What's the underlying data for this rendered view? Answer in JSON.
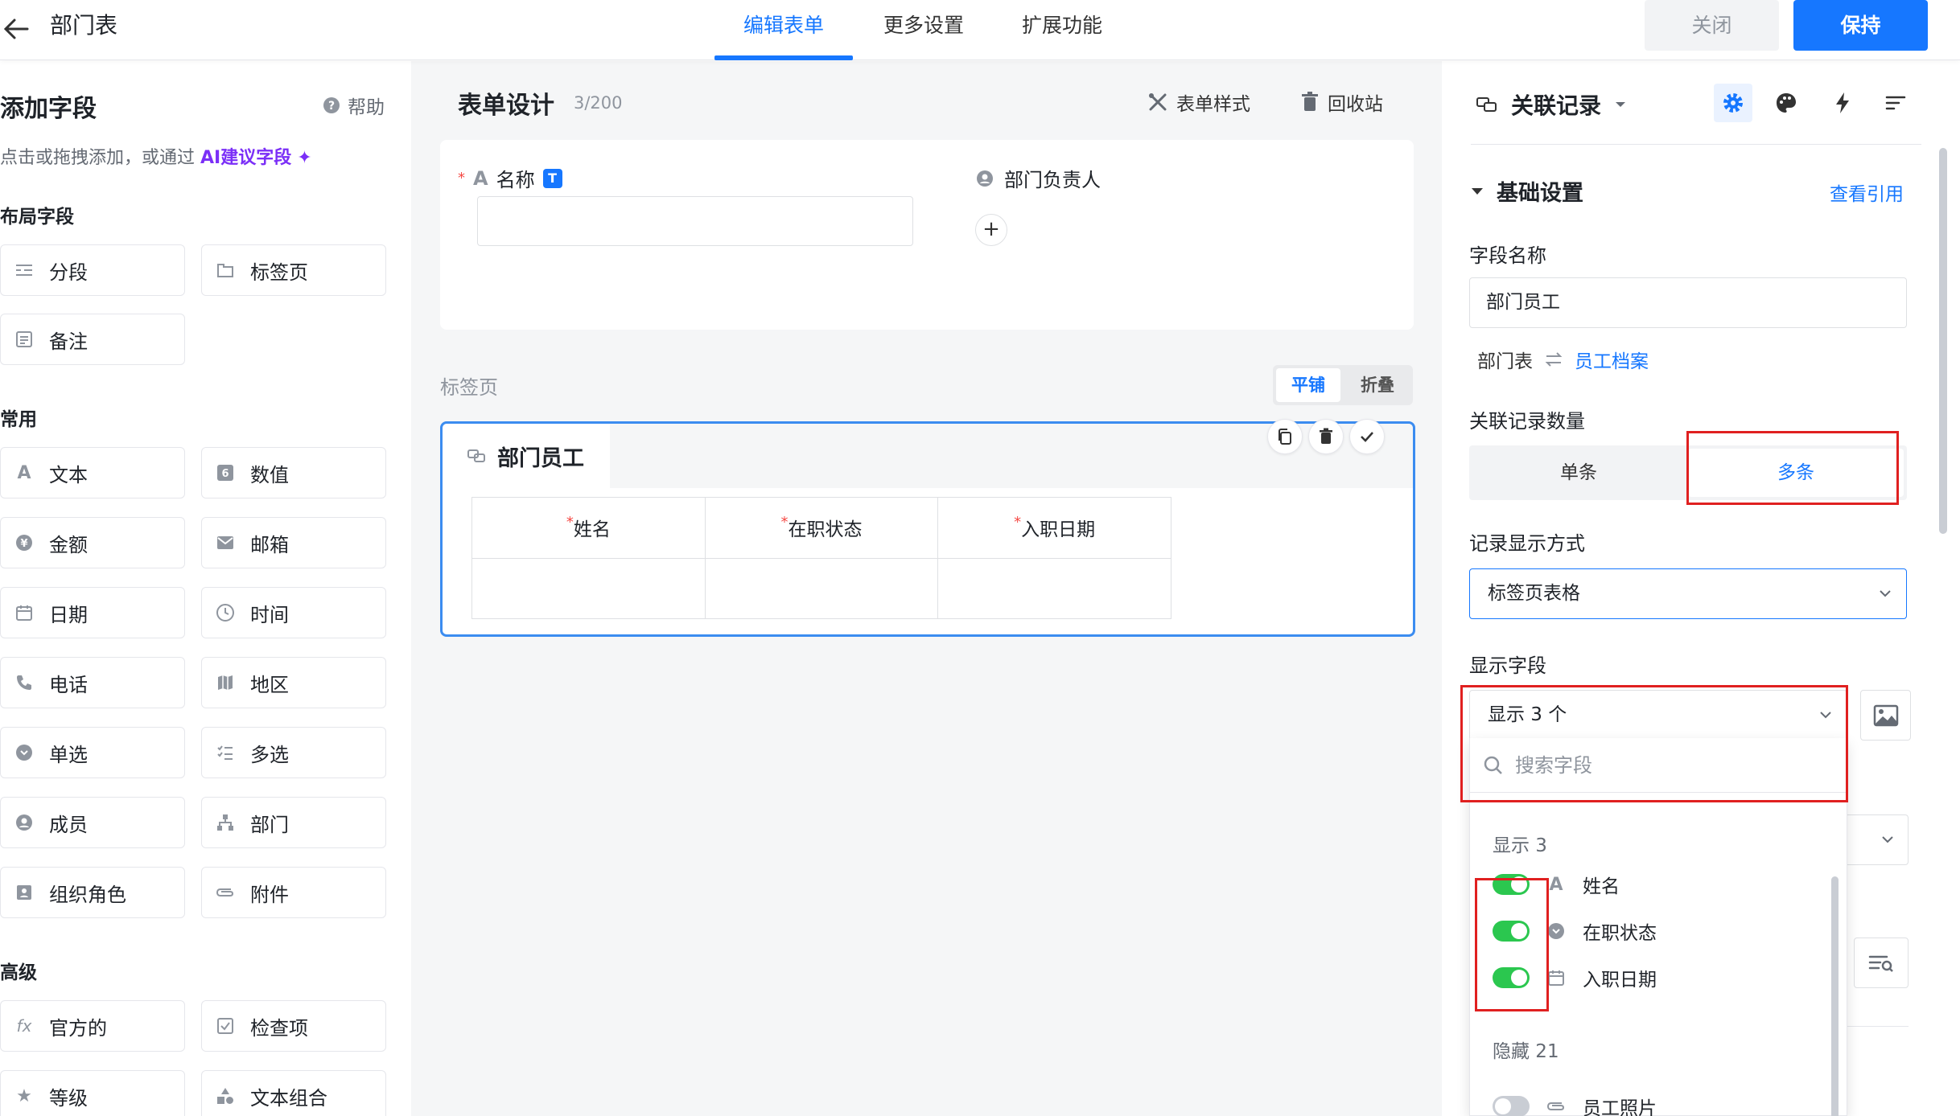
{
  "header": {
    "title": "部门表",
    "tabs": [
      "编辑表单",
      "更多设置",
      "扩展功能"
    ],
    "close_label": "关闭",
    "save_label": "保持"
  },
  "left_panel": {
    "title": "添加字段",
    "help": "帮助",
    "hint_prefix": "点击或拖拽添加，或通过",
    "hint_ai": "AI建议字段",
    "groups": {
      "layout": "布局字段",
      "common": "常用",
      "advanced": "高级"
    },
    "layout_fields": [
      "分段",
      "标签页",
      "备注"
    ],
    "common_fields": [
      "文本",
      "数值",
      "金额",
      "邮箱",
      "日期",
      "时间",
      "电话",
      "地区",
      "单选",
      "多选",
      "成员",
      "部门",
      "组织角色",
      "附件"
    ],
    "advanced_fields": [
      "官方的",
      "检查项",
      "等级",
      "文本组合"
    ]
  },
  "center": {
    "title": "表单设计",
    "count": "3/200",
    "form_style": "表单样式",
    "recycle": "回收站",
    "name_label": "名称",
    "name_badge": "T",
    "manager_label": "部门负责人",
    "add_symbol": "+",
    "tabs_label": "标签页",
    "toggle_tile": "平铺",
    "toggle_fold": "折叠",
    "subtable_title": "部门员工",
    "columns": [
      "姓名",
      "在职状态",
      "入职日期"
    ]
  },
  "right_panel": {
    "relation_title": "关联记录",
    "basic_settings": "基础设置",
    "view_reference": "查看引用",
    "field_name_label": "字段名称",
    "field_name_value": "部门员工",
    "source_table": "部门表",
    "target_table": "员工档案",
    "count_label": "关联记录数量",
    "count_single": "单条",
    "count_multi": "多条",
    "display_mode_label": "记录显示方式",
    "display_mode_value": "标签页表格",
    "display_fields_label": "显示字段",
    "display_fields_value": "显示 3 个",
    "search_placeholder": "搜索字段",
    "shown_title": "显示 3",
    "shown_fields": [
      "姓名",
      "在职状态",
      "入职日期"
    ],
    "hidden_title": "隐藏 21",
    "hidden_fields": [
      "员工照片"
    ]
  },
  "colors": {
    "primary": "#1677ff",
    "switch_on": "#2bc74f",
    "annotation": "#e02020",
    "ai_purple": "#7b2ff7"
  }
}
